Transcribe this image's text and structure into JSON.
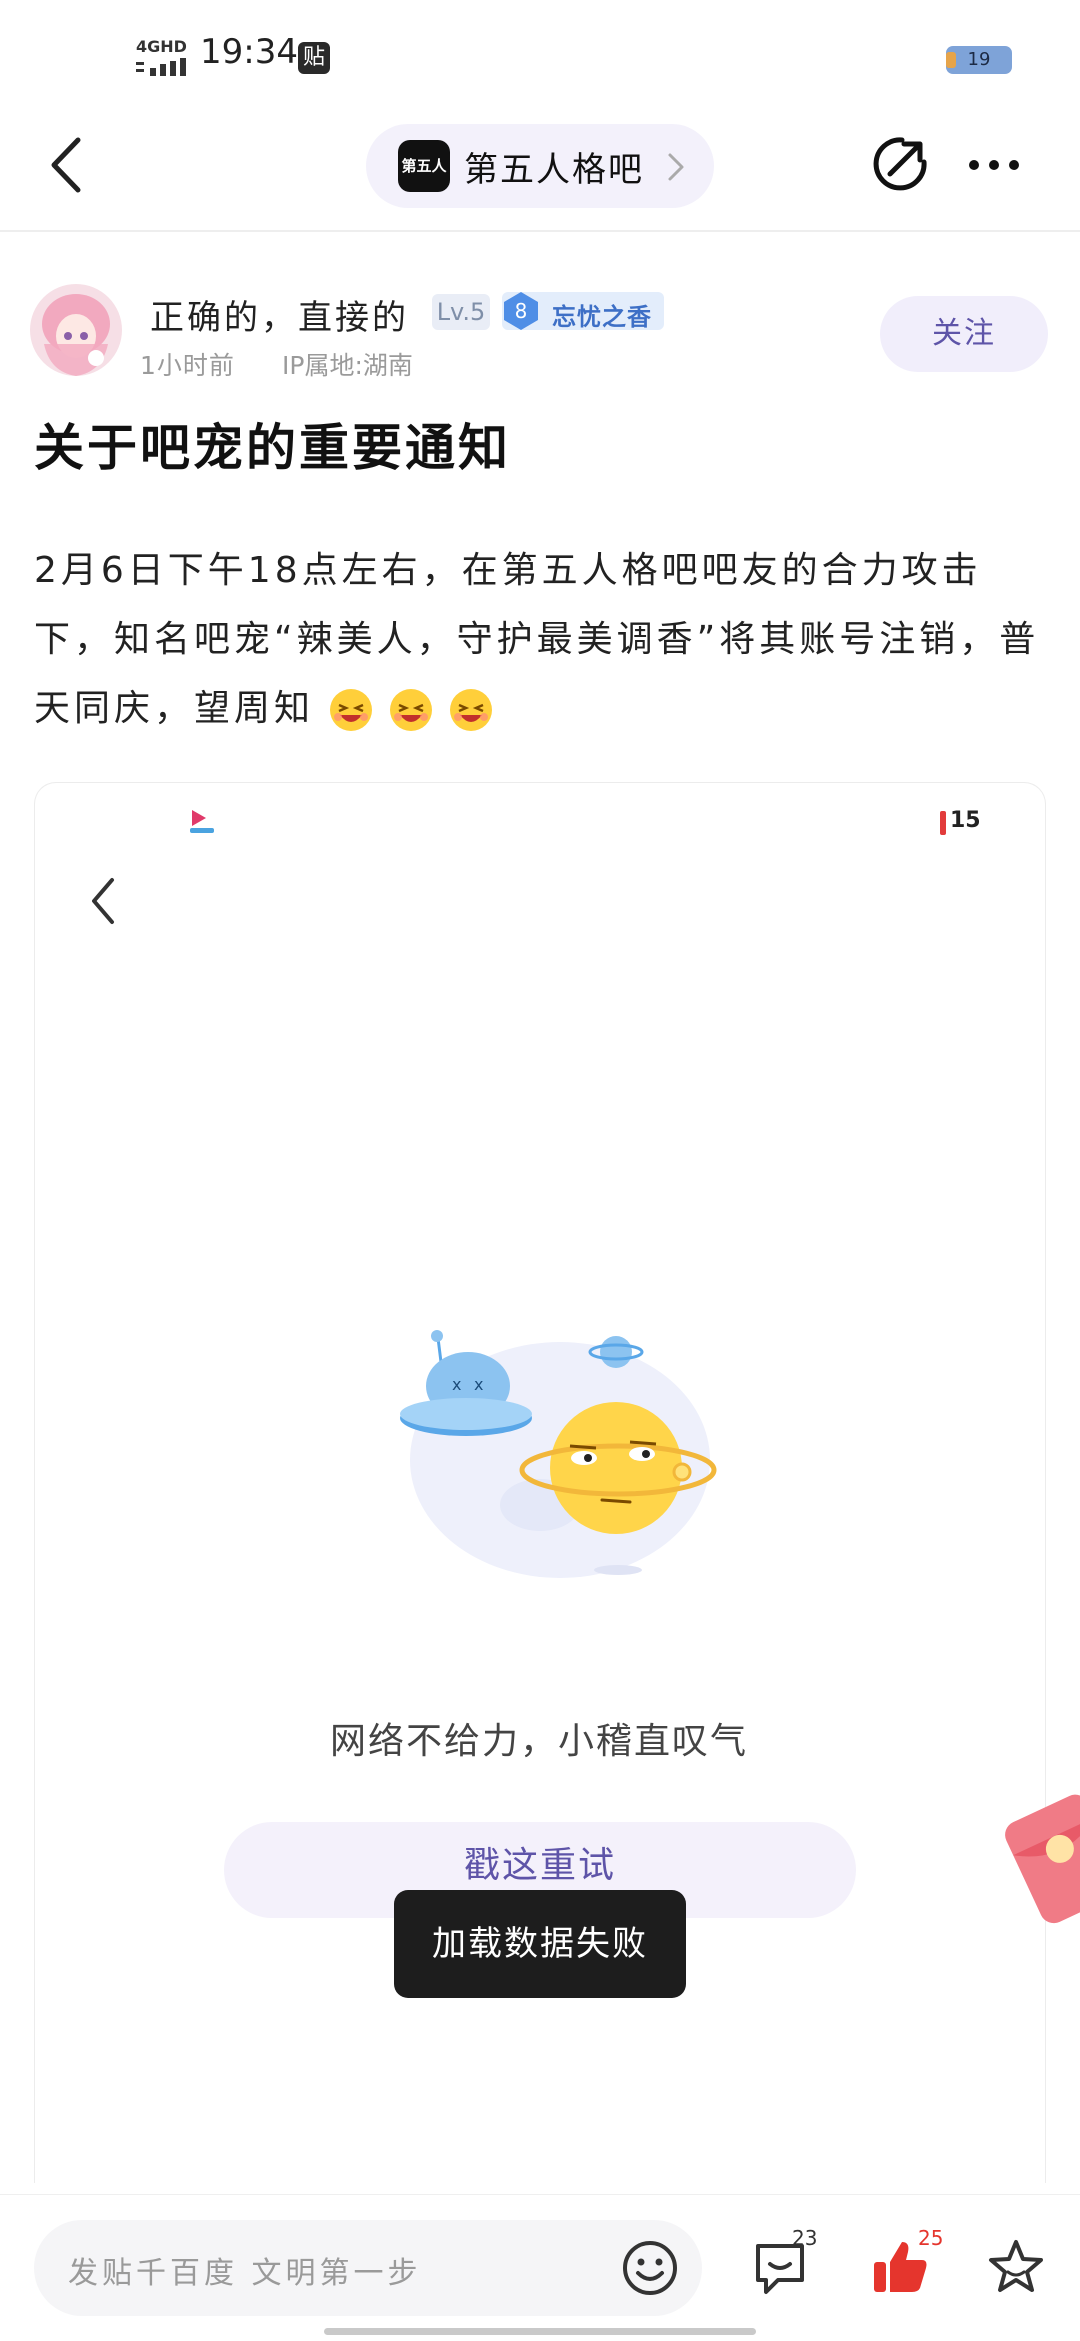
{
  "status": {
    "network": "4GHD",
    "time": "19:34",
    "notification_badge": "贴",
    "battery": "19"
  },
  "nav": {
    "forum_logo_text": "第五人格",
    "forum_name": "第五人格吧"
  },
  "author": {
    "name": "正确的，直接的",
    "level": "Lv.5",
    "fan_level": "8",
    "fan_title": "忘忧之香",
    "post_time": "1小时前",
    "ip_location": "IP属地:湖南",
    "follow_label": "关注"
  },
  "post": {
    "title": "关于吧宠的重要通知",
    "body": "2月6日下午18点左右，在第五人格吧吧友的合力攻击下，知名吧宠“辣美人，守护最美调香”将其账号注销，普天同庆，望周知"
  },
  "embed": {
    "battery_text": "15",
    "error_message": "网络不给力，小稽直叹气",
    "retry_label": "戳这重试"
  },
  "toast": {
    "message": "加载数据失败"
  },
  "bottom": {
    "comment_placeholder": "发贴千百度 文明第一步",
    "reply_count": "23",
    "like_count": "25"
  },
  "colors": {
    "accent": "#5e54a8",
    "like": "#e5352d",
    "badge_blue": "#3d6fc6"
  }
}
